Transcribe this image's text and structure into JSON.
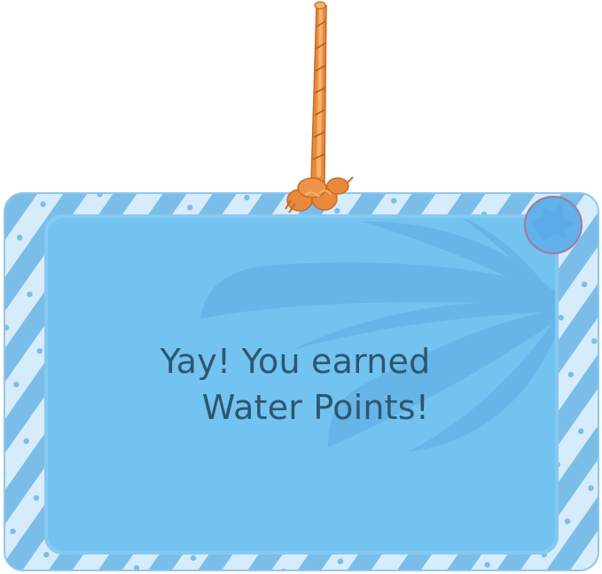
{
  "popup": {
    "message_line1": "Yay! You earned",
    "message_line2": "Water Points!"
  },
  "colors": {
    "panel_fill": "#72c3f0",
    "frame_light": "#d6ecfb",
    "frame_stripe": "#7bbde9",
    "leaf_shadow": "#5fa8e2",
    "text": "#2e5670",
    "rope": "#e88a3c",
    "rope_highlight": "#f5b26b",
    "close_ring": "#a4799a"
  },
  "icons": {
    "leaf": "palm-leaf-icon",
    "rope": "hanging-rope-icon",
    "close": "close-circle-icon"
  }
}
